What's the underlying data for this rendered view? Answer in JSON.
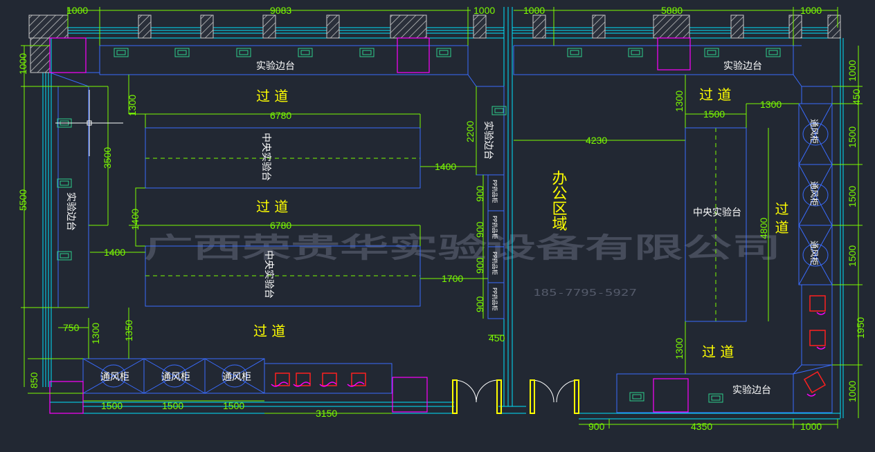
{
  "colors": {
    "background": "#222833",
    "wall": "#00e5ff",
    "furniture": "#3a6cff",
    "dimension": "#7CFC00",
    "accent_magenta": "#ff00ff",
    "aisle_text": "#ffff00",
    "equipment_red": "#ff2020",
    "door_yellow": "#ffff00"
  },
  "dimensions": {
    "top_left_1000": "1000",
    "top_9083": "9083",
    "top_mid_1000": "1000",
    "top_right_1000a": "1000",
    "top_5880": "5880",
    "top_right_1000b": "1000",
    "left_1000": "1000",
    "left_5500": "5500",
    "left_850": "850",
    "left_1300": "1300",
    "left_3500": "3500",
    "left_1400_v": "1400",
    "left_1400_h": "1400",
    "left_750": "750",
    "left_1300b": "1300",
    "left_1350": "1350",
    "bench1_6780": "6780",
    "bench2_6780": "6780",
    "right_of_bench1_1400": "1400",
    "right_of_bench2_1700": "1700",
    "side_2200": "2200",
    "v900_1": "900",
    "v900_2": "900",
    "v900_3": "900",
    "v900_4": "900",
    "h450": "450",
    "bottom_1500a": "1500",
    "bottom_1500b": "1500",
    "bottom_1500c": "1500",
    "bottom_3150": "3150",
    "r_1300": "1300",
    "r_1500": "1500",
    "r_1300b": "1300",
    "r_4230": "4230",
    "r_4800": "4800",
    "r_1300c": "1300",
    "r_edge_1000": "1000",
    "r_edge_450": "450",
    "r_edge_1500a": "1500",
    "r_edge_1500b": "1500",
    "r_edge_1500c": "1500",
    "r_edge_1950": "1950",
    "r_edge_1000b": "1000",
    "r_bottom_900": "900",
    "r_bottom_4350": "4350",
    "r_bottom_1000": "1000"
  },
  "labels": {
    "top_bench_left": "实验边台",
    "top_bench_right": "实验边台",
    "left_side_bench": "实验边台",
    "mid_side_bench": "实验边台",
    "center_bench_1": "中央实验台",
    "center_bench_2": "中央实验台",
    "right_center_bench": "中央实验台",
    "bottom_right_bench": "实验边台",
    "fume_hood": "通风柜",
    "office_area": "办公区域",
    "aisle": "过 道",
    "aisle_v": "过 道",
    "small_cabinet": "PP药品柜"
  },
  "watermark": {
    "company": "广西荣贵华实验设备有限公司",
    "phone": "185-7795-5927"
  }
}
